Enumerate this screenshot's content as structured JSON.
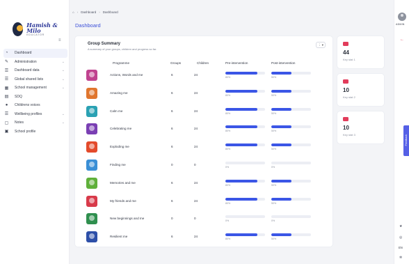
{
  "brand": {
    "title": "Hamish & Milo",
    "subtitle": "EDUCATOR"
  },
  "breadcrumb": {
    "home_icon": "home-icon",
    "items": [
      "Dashboard",
      "Dashboard"
    ]
  },
  "page_title": "Dashboard",
  "sidebar": {
    "items": [
      {
        "label": "Dashboard",
        "icon": "dashboard-icon",
        "has_submenu": false,
        "active": true
      },
      {
        "label": "Administration",
        "icon": "wrench-icon",
        "has_submenu": true
      },
      {
        "label": "Dashboard data",
        "icon": "list-icon",
        "has_submenu": true
      },
      {
        "label": "Global shared lists",
        "icon": "list-icon",
        "has_submenu": true
      },
      {
        "label": "School management",
        "icon": "building-icon",
        "has_submenu": true
      },
      {
        "label": "SDQ",
        "icon": "document-icon",
        "has_submenu": false
      },
      {
        "label": "Childrens voices",
        "icon": "chat-icon",
        "has_submenu": false
      },
      {
        "label": "Wellbeing profiles",
        "icon": "list-icon",
        "has_submenu": true
      },
      {
        "label": "Notes",
        "icon": "note-icon",
        "has_submenu": true
      },
      {
        "label": "School profile",
        "icon": "profile-icon",
        "has_submenu": false
      }
    ]
  },
  "group_summary": {
    "title": "Group Summary",
    "subtitle": "A summary of your groups, children and progress so far.",
    "menu_label": "⋮ ▾",
    "columns": {
      "programme": "Programme",
      "groups": "Groups",
      "children": "Children",
      "pre": "Pre-intervention",
      "post": "Post-intervention"
    },
    "rows": [
      {
        "programme": "Actions, Words and me",
        "groups": "6",
        "children": "24",
        "pre": 0.8,
        "pre_label": "80%",
        "post": 0.5,
        "post_label": "50%",
        "color": "#c0428f"
      },
      {
        "programme": "Amazing me",
        "groups": "6",
        "children": "24",
        "pre": 0.8,
        "pre_label": "80%",
        "post": 0.5,
        "post_label": "50%",
        "color": "#e0762e"
      },
      {
        "programme": "Calm me",
        "groups": "6",
        "children": "24",
        "pre": 0.8,
        "pre_label": "80%",
        "post": 0.5,
        "post_label": "50%",
        "color": "#2aa1b3"
      },
      {
        "programme": "Celebrating me",
        "groups": "6",
        "children": "24",
        "pre": 0.8,
        "pre_label": "80%",
        "post": 0.5,
        "post_label": "50%",
        "color": "#7a3fb3"
      },
      {
        "programme": "Exploding me",
        "groups": "6",
        "children": "24",
        "pre": 0.8,
        "pre_label": "80%",
        "post": 0.5,
        "post_label": "50%",
        "color": "#e34a2b"
      },
      {
        "programme": "Finding me",
        "groups": "0",
        "children": "0",
        "pre": 0,
        "pre_label": "0%",
        "post": 0,
        "post_label": "0%",
        "color": "#3a8fd6"
      },
      {
        "programme": "Memories and me",
        "groups": "6",
        "children": "24",
        "pre": 0.8,
        "pre_label": "80%",
        "post": 0.5,
        "post_label": "50%",
        "color": "#5fb03a"
      },
      {
        "programme": "My friends and me",
        "groups": "6",
        "children": "24",
        "pre": 0.8,
        "pre_label": "80%",
        "post": 0.5,
        "post_label": "50%",
        "color": "#d83a4a"
      },
      {
        "programme": "New beginnings and me",
        "groups": "0",
        "children": "0",
        "pre": 0,
        "pre_label": "0%",
        "post": 0,
        "post_label": "0%",
        "color": "#2f8f4e"
      },
      {
        "programme": "Resilient me",
        "groups": "6",
        "children": "24",
        "pre": 0.8,
        "pre_label": "80%",
        "post": 0.5,
        "post_label": "50%",
        "color": "#2d4fa8"
      }
    ]
  },
  "stats": [
    {
      "value": "44",
      "label": "Key stat 1",
      "icon": "stat-icon"
    },
    {
      "value": "10",
      "label": "Key stat 2",
      "icon": "stat-icon"
    },
    {
      "value": "10",
      "label": "Key stat 3",
      "icon": "stat-icon"
    }
  ],
  "user": {
    "label": "ADMIN"
  },
  "feedback_label": "Feedback",
  "language": "EN",
  "colors": {
    "accent": "#3b56e6",
    "title": "#3b4fd8",
    "stat_icon": "#e23c5b"
  }
}
